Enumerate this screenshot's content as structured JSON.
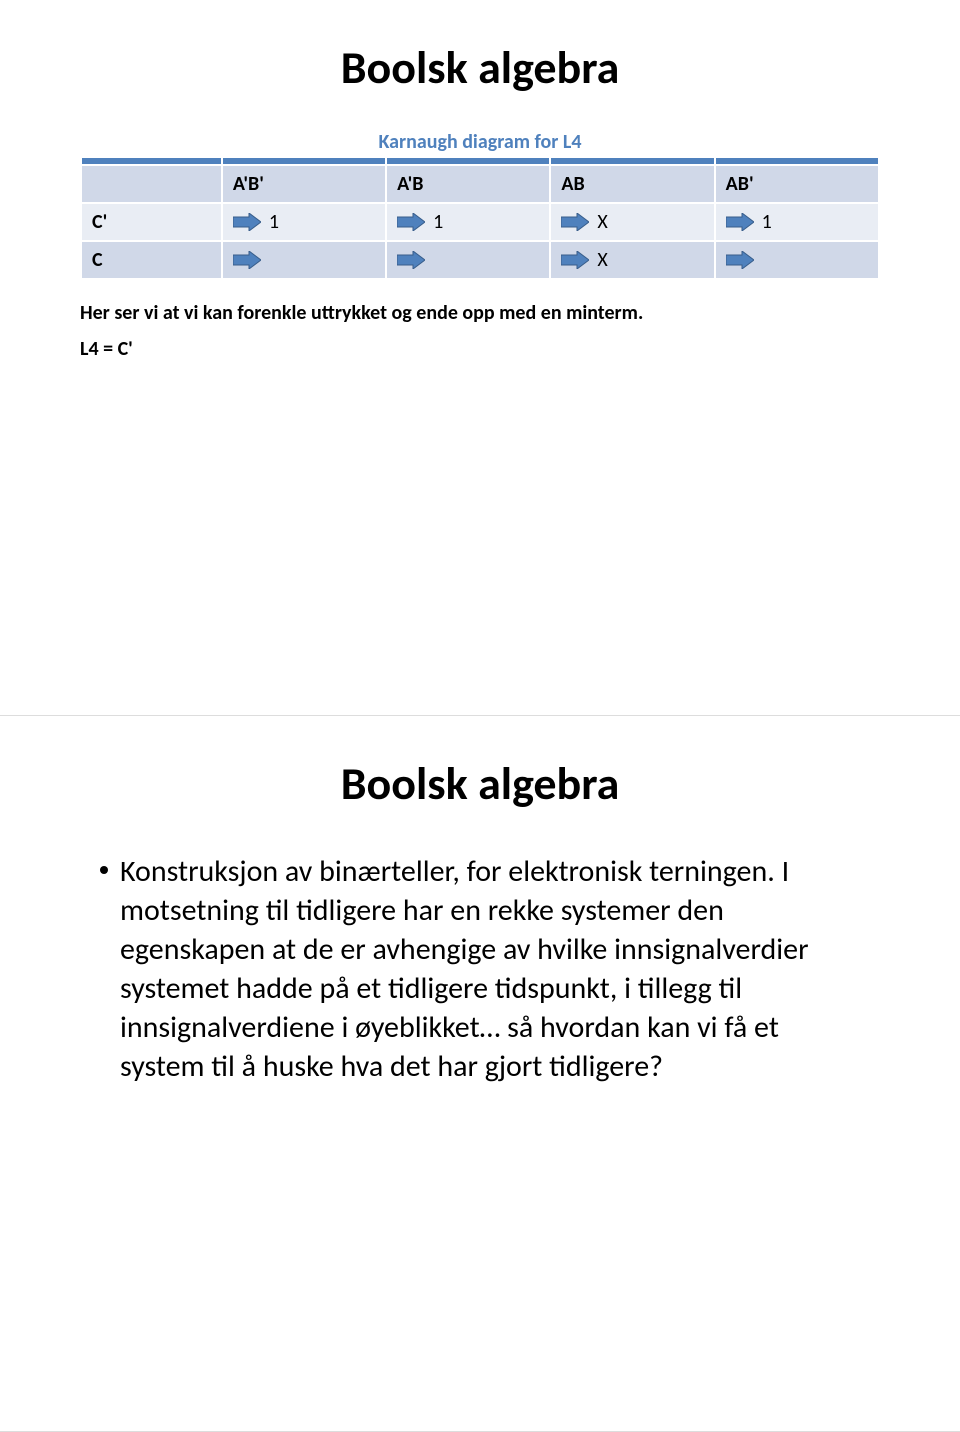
{
  "slide1": {
    "title": "Boolsk algebra",
    "tableTitle": "Karnaugh diagram for L4",
    "headers": [
      "",
      "A'B'",
      "A'B",
      "AB",
      "AB'"
    ],
    "rows": [
      {
        "label": "C'",
        "cells": [
          "1",
          "1",
          "X",
          "1"
        ]
      },
      {
        "label": "C",
        "cells": [
          "",
          "",
          "X",
          ""
        ]
      }
    ],
    "captionLine1": "Her ser vi at vi kan forenkle uttrykket og ende opp med en minterm.",
    "captionLine2": "L4 = C'"
  },
  "slide2": {
    "title": "Boolsk algebra",
    "bulletText": "Konstruksjon av binærteller, for elektronisk terningen. I motsetning til tidligere har en rekke systemer den egenskapen at de er avhengige av hvilke innsignalverdier systemet hadde på et tidligere tidspunkt, i tillegg til innsignalverdiene i øyeblikket… så hvordan kan vi få et system til å huske hva det har gjort tidligere?"
  },
  "colors": {
    "accent": "#4f81bd",
    "rowLight": "#e9edf4",
    "rowDark": "#d0d8e8"
  }
}
